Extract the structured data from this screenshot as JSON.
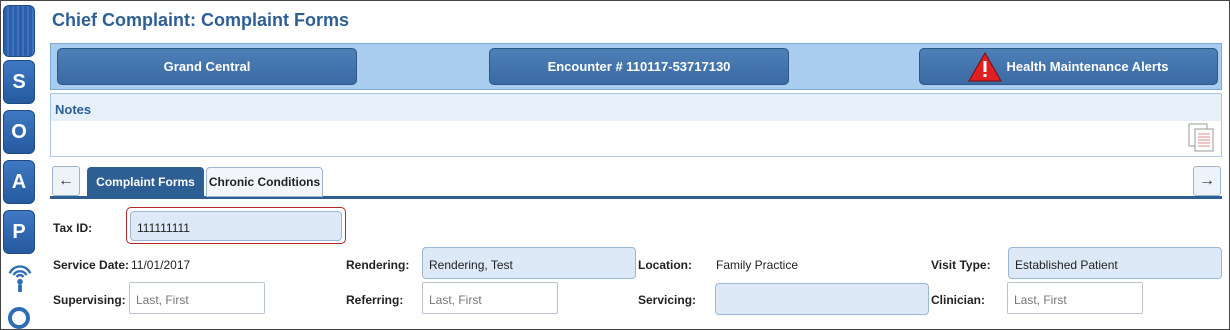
{
  "page": {
    "title": "Chief Complaint: Complaint Forms"
  },
  "rail": {
    "items": [
      "S",
      "O",
      "A",
      "P"
    ],
    "icons": [
      "hamburger-icon",
      "wireless-device-icon",
      "search-icon"
    ]
  },
  "header": {
    "grand_central": "Grand Central",
    "encounter": "Encounter # 110117-53717130",
    "alerts": "Health Maintenance Alerts"
  },
  "notes": {
    "label": "Notes"
  },
  "tabs": [
    {
      "label": "Complaint Forms",
      "active": true
    },
    {
      "label": "Chronic Conditions",
      "active": false
    }
  ],
  "form": {
    "tax_id": {
      "label": "Tax ID:",
      "value": "111111111"
    },
    "service_date": {
      "label": "Service Date:",
      "value": "11/01/2017"
    },
    "rendering": {
      "label": "Rendering:",
      "value": "Rendering, Test"
    },
    "location": {
      "label": "Location:",
      "value": "Family Practice"
    },
    "visit_type": {
      "label": "Visit Type:",
      "value": "Established Patient"
    },
    "supervising": {
      "label": "Supervising:",
      "placeholder": "Last, First"
    },
    "referring": {
      "label": "Referring:",
      "placeholder": "Last, First"
    },
    "servicing": {
      "label": "Servicing:",
      "value": ""
    },
    "clinician": {
      "label": "Clinician:",
      "placeholder": "Last, First"
    }
  },
  "colors": {
    "brand": "#2e5f94",
    "header_bar": "#a8cdef",
    "field": "#dde9f7",
    "tax_highlight": "#b2272a"
  }
}
